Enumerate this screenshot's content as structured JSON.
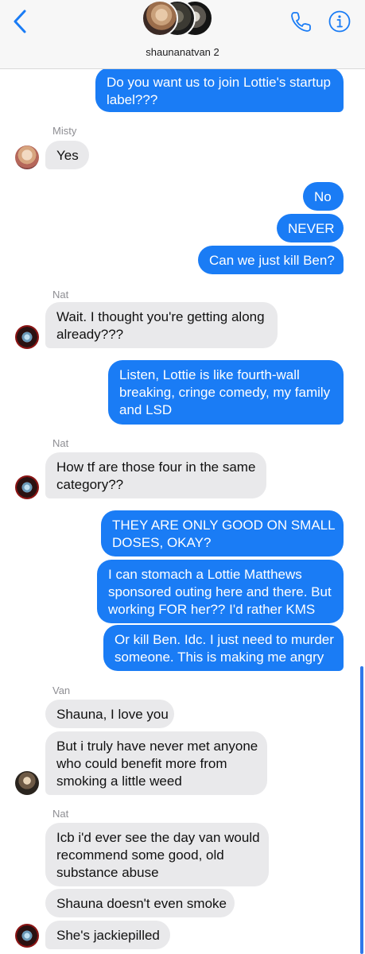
{
  "header": {
    "title": "shaunanatvan 2"
  },
  "messages": [
    {
      "from": "me",
      "text": "Do you want us to join Lottie's startup label???"
    },
    {
      "from": "Misty",
      "sender_label": "Misty",
      "text": "Yes"
    },
    {
      "from": "me",
      "text": "No"
    },
    {
      "from": "me",
      "text": "NEVER"
    },
    {
      "from": "me",
      "text": "Can we just kill Ben?"
    },
    {
      "from": "Nat",
      "sender_label": "Nat",
      "text": "Wait. I thought you're getting along already???"
    },
    {
      "from": "me",
      "text": "Listen, Lottie is like fourth-wall breaking, cringe comedy, my family and LSD"
    },
    {
      "from": "Nat",
      "sender_label": "Nat",
      "text": "How tf are those four in the same category??"
    },
    {
      "from": "me",
      "text": "THEY ARE ONLY GOOD ON SMALL DOSES, OKAY?"
    },
    {
      "from": "me",
      "text": "I can stomach a Lottie Matthews sponsored outing here and there. But working FOR her?? I'd rather KMS"
    },
    {
      "from": "me",
      "text": "Or kill Ben. Idc. I just need to murder someone. This is making me angry"
    },
    {
      "from": "Van",
      "sender_label": "Van",
      "text": "Shauna, I love you"
    },
    {
      "from": "Van",
      "text": "But i truly have never met anyone who could benefit more from smoking a little weed"
    },
    {
      "from": "Nat",
      "sender_label": "Nat",
      "text": "Icb i'd ever see the day van would recommend some good, old substance abuse"
    },
    {
      "from": "Nat",
      "text": "Shauna doesn't even smoke"
    },
    {
      "from": "Nat",
      "text": "She's jackiepilled"
    }
  ],
  "lines": {
    "m0": [
      "Do you want us to join Lottie's startup",
      "label???"
    ],
    "m5": [
      "Wait. I thought you're getting along",
      "already???"
    ],
    "m6": [
      "Listen, Lottie is like fourth-wall",
      "breaking, cringe comedy, my family",
      "and LSD"
    ],
    "m7": [
      "How tf are those four in the same",
      "category??"
    ],
    "m8": [
      "THEY ARE ONLY GOOD ON SMALL",
      "DOSES, OKAY?"
    ],
    "m9": [
      "I can stomach a Lottie Matthews",
      "sponsored outing here and there. But",
      "working FOR her?? I'd rather KMS"
    ],
    "m10": [
      "Or kill Ben. Idc. I just need to murder",
      "someone. This is making me angry"
    ],
    "m12": [
      "But i truly have never met anyone",
      "who could benefit more from",
      "smoking a little weed"
    ],
    "m13": [
      "Icb i'd ever see the day van would",
      "recommend some good, old",
      "substance abuse"
    ]
  },
  "colors": {
    "outgoing_bubble": "#1a7cf5",
    "incoming_bubble": "#e9e9eb",
    "accent": "#1a7cf5",
    "sender_label": "#8e8e93"
  },
  "icons": [
    "back-chevron-icon",
    "phone-icon",
    "info-icon"
  ]
}
